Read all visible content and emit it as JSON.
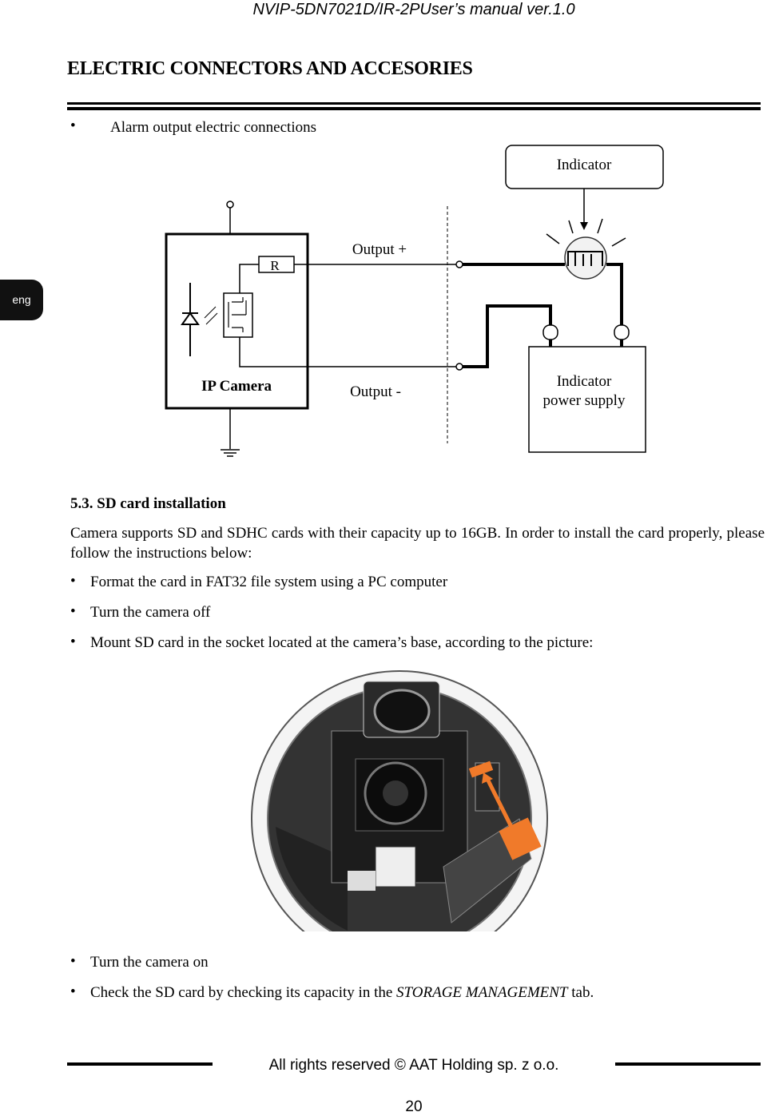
{
  "header": {
    "manual_title": "NVIP-5DN7021D/IR-2PUser’s manual ver.1.0"
  },
  "section_title": "ELECTRIC CONNECTORS AND ACCESORIES",
  "side_tab": {
    "label": "eng"
  },
  "alarm_bullet": "Alarm output electric connections",
  "diagram": {
    "indicator": "Indicator",
    "output_plus": "Output  +",
    "output_minus": "Output  -",
    "ip_camera": "IP Camera",
    "resistor": "R",
    "power_supply_line1": "Indicator",
    "power_supply_line2": "power  supply"
  },
  "sd_section": {
    "heading": "5.3. SD card installation",
    "intro": "Camera supports SD and SDHC cards with their capacity up to 16GB. In order to install the card properly, please follow the instructions below:",
    "steps": [
      "Format the card in FAT32 file system using a PC computer",
      "Turn the camera off",
      "Mount SD card in the socket located at the camera’s base, according to the picture:"
    ],
    "steps_after": [
      "Turn the camera on"
    ],
    "last_step": {
      "before": "Check the SD card by checking its capacity in the ",
      "italic": "STORAGE MANAGEMENT",
      "after": " tab."
    }
  },
  "colors": {
    "sd_card_accent": "#f07a2a"
  },
  "footer": {
    "rights": "All rights reserved © AAT Holding sp. z o.o.",
    "page_number": "20"
  }
}
